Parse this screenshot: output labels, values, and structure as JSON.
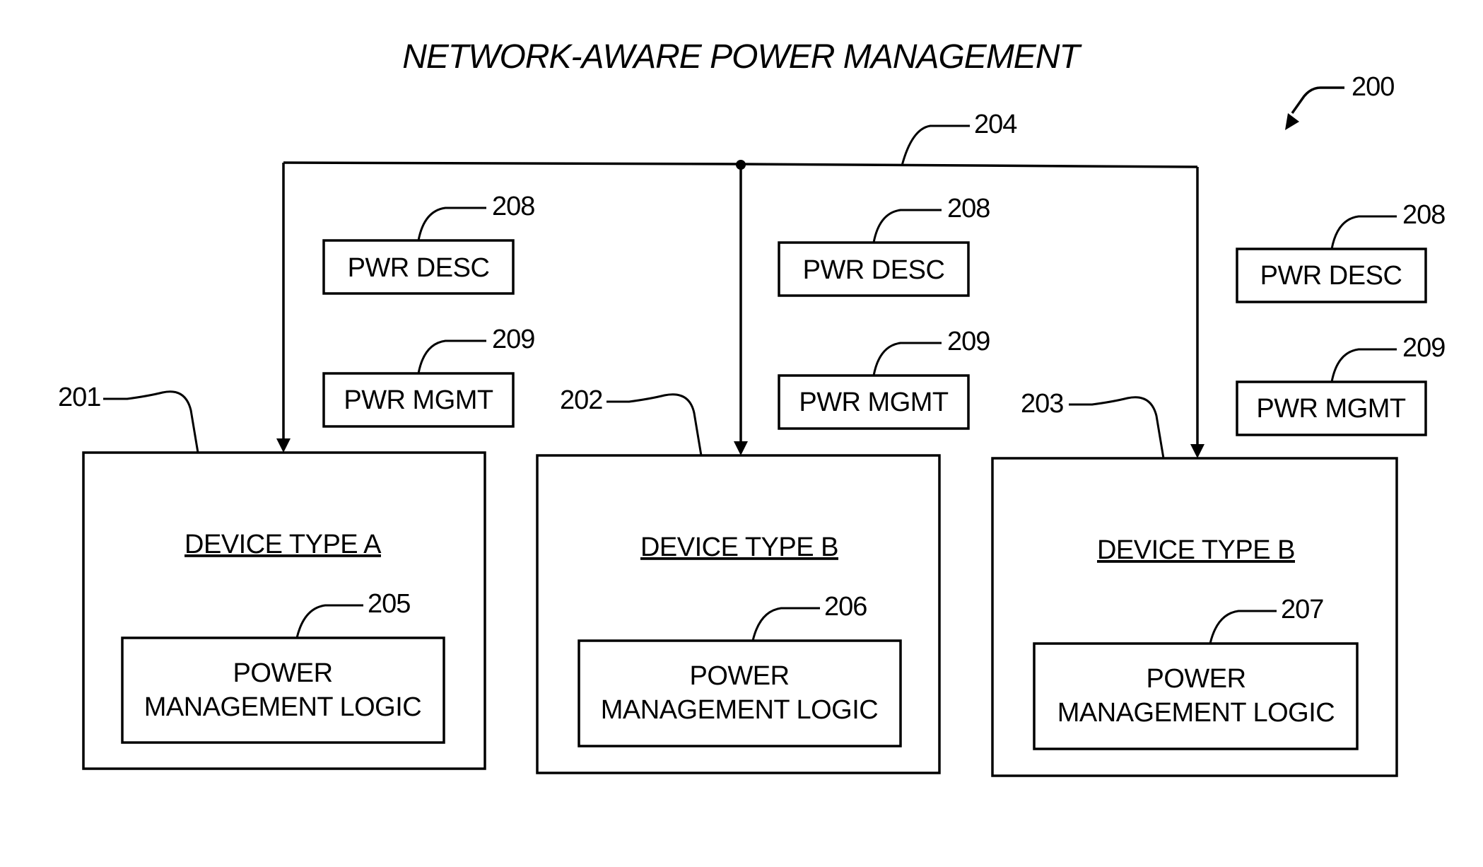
{
  "figure": {
    "title": "NETWORK-AWARE POWER MANAGEMENT",
    "figure_ref": "200",
    "network_ref": "204"
  },
  "devices": [
    {
      "ref": "201",
      "label": "DEVICE TYPE A",
      "logic": {
        "ref": "205",
        "line1": "POWER",
        "line2": "MANAGEMENT LOGIC"
      }
    },
    {
      "ref": "202",
      "label": "DEVICE TYPE B",
      "logic": {
        "ref": "206",
        "line1": "POWER",
        "line2": "MANAGEMENT LOGIC"
      }
    },
    {
      "ref": "203",
      "label": "DEVICE TYPE B",
      "logic": {
        "ref": "207",
        "line1": "POWER",
        "line2": "MANAGEMENT LOGIC"
      }
    }
  ],
  "messages": [
    {
      "desc_ref": "208",
      "desc_label": "PWR DESC",
      "mgmt_ref": "209",
      "mgmt_label": "PWR MGMT"
    },
    {
      "desc_ref": "208",
      "desc_label": "PWR DESC",
      "mgmt_ref": "209",
      "mgmt_label": "PWR MGMT"
    },
    {
      "desc_ref": "208",
      "desc_label": "PWR DESC",
      "mgmt_ref": "209",
      "mgmt_label": "PWR MGMT"
    }
  ]
}
